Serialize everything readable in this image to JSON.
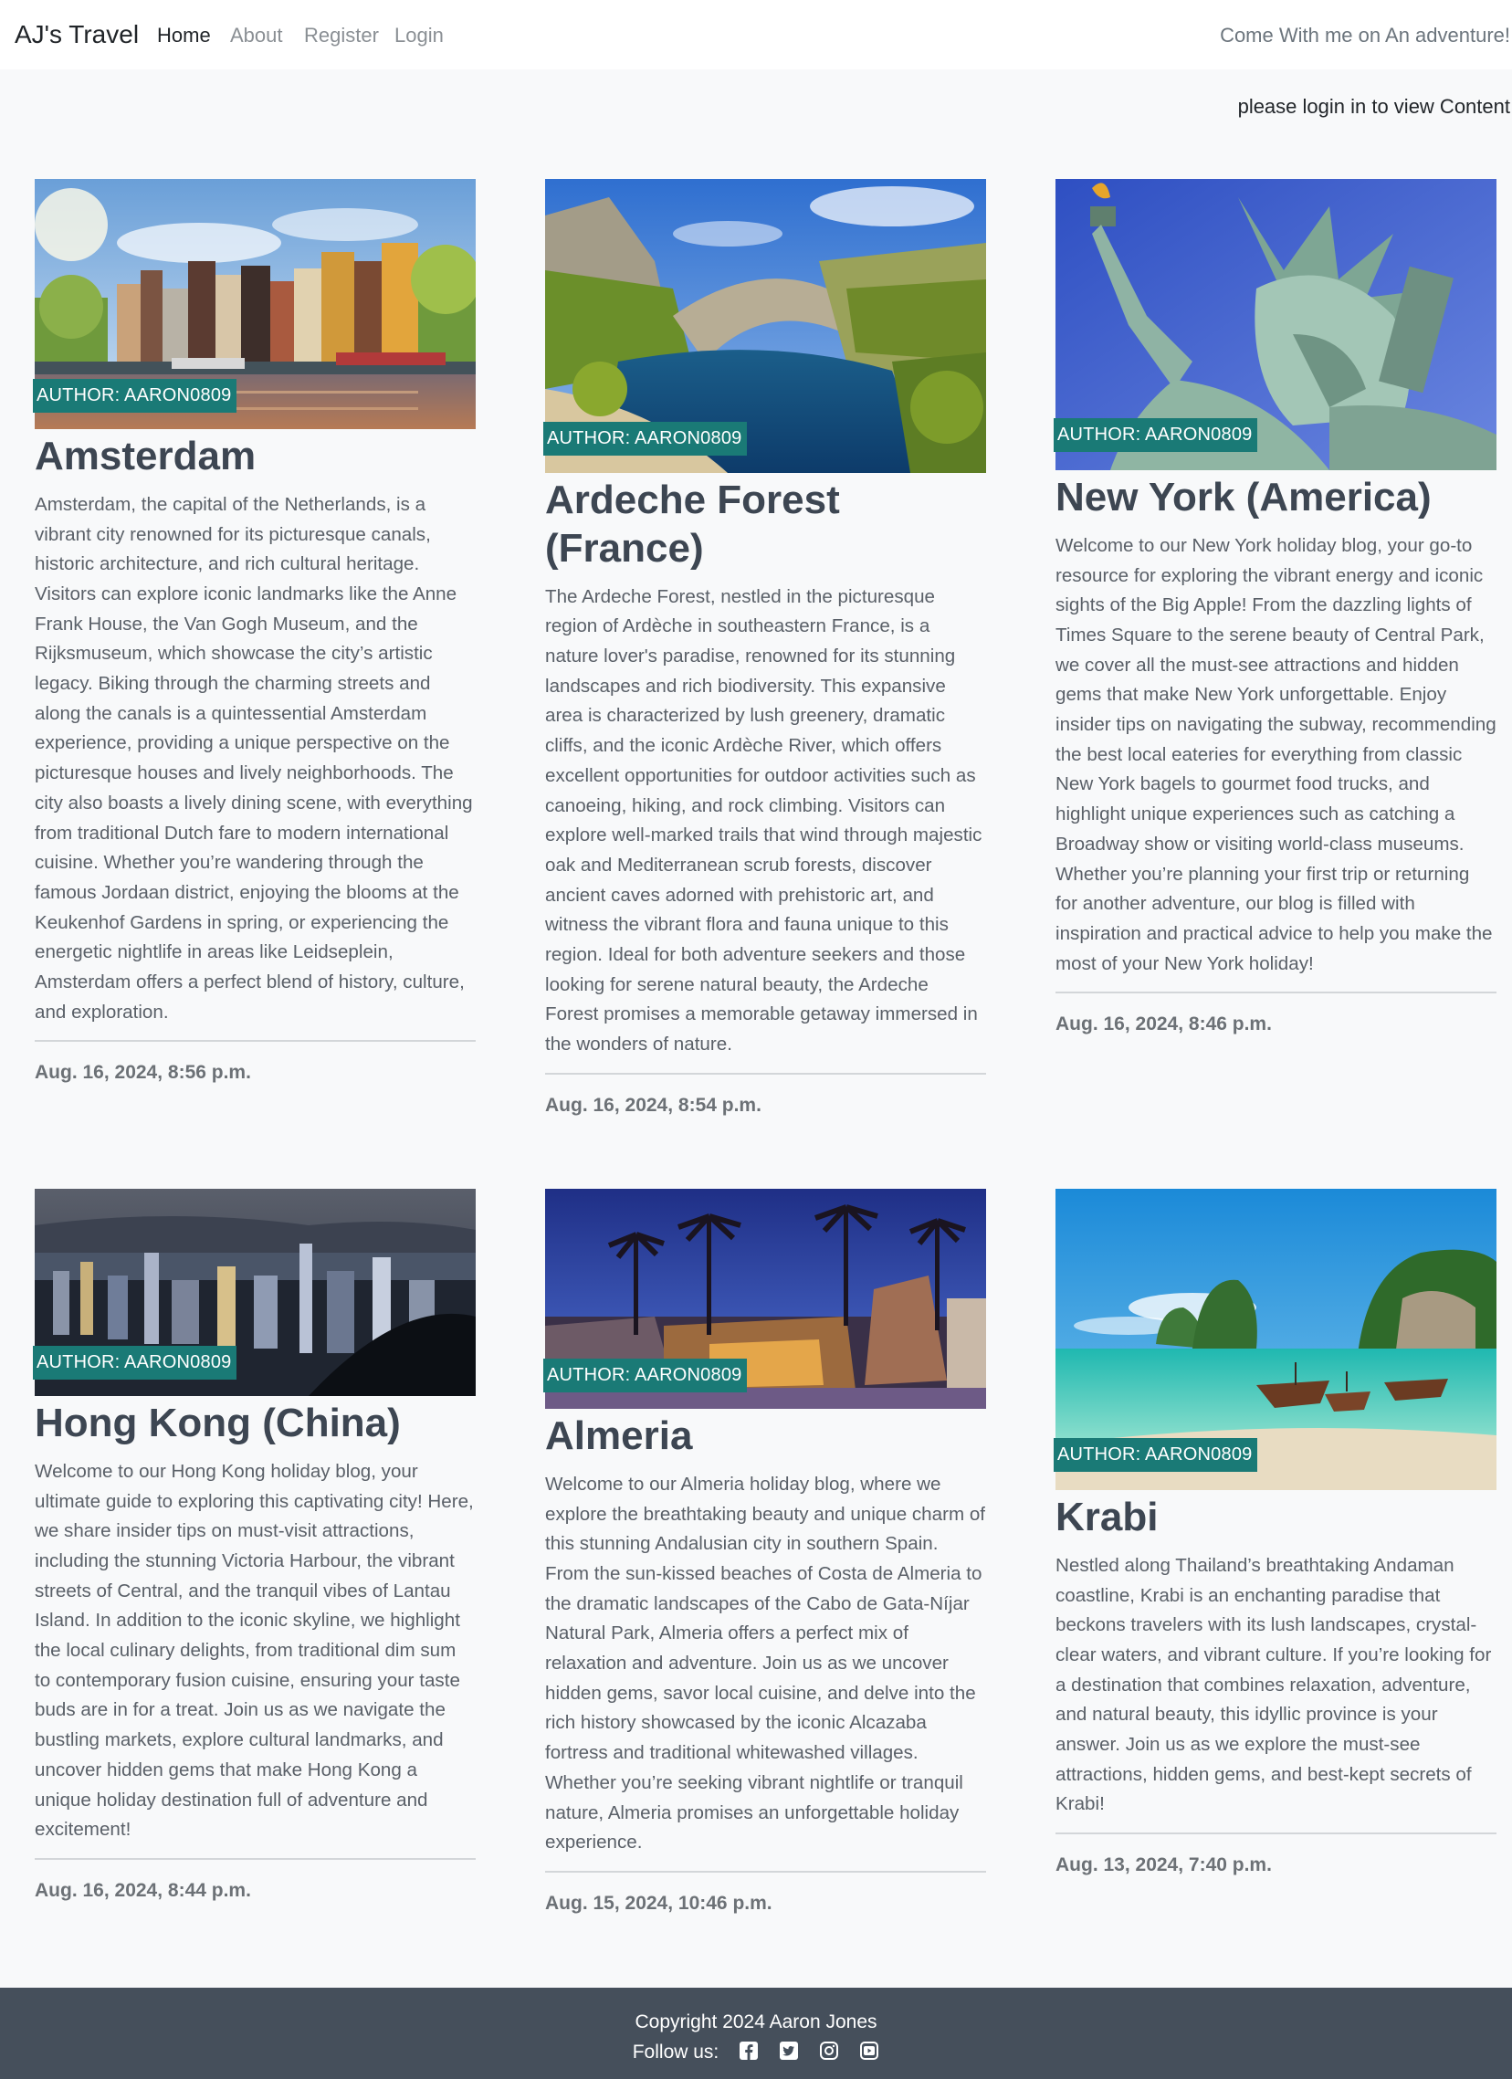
{
  "navbar": {
    "brand": "AJ's Travel",
    "links": [
      "Home",
      "About",
      "Register",
      "Login"
    ],
    "tagline": "Come With me on An adventure!"
  },
  "login_note": "please login in to view Content",
  "posts": [
    {
      "author": "AUTHOR: AARON0809",
      "title": "Amsterdam",
      "body": "Amsterdam, the capital of the Netherlands, is a vibrant city renowned for its picturesque canals, historic architecture, and rich cultural heritage. Visitors can explore iconic landmarks like the Anne Frank House, the Van Gogh Museum, and the Rijksmuseum, which showcase the city’s artistic legacy. Biking through the charming streets and along the canals is a quintessential Amsterdam experience, providing a unique perspective on the picturesque houses and lively neighborhoods. The city also boasts a lively dining scene, with everything from traditional Dutch fare to modern international cuisine. Whether you’re wandering through the famous Jordaan district, enjoying the blooms at the Keukenhof Gardens in spring, or experiencing the energetic nightlife in areas like Leidseplein, Amsterdam offers a perfect blend of history, culture, and exploration.",
      "date": "Aug. 16, 2024, 8:56 p.m.",
      "image": "amsterdam canal houses photo"
    },
    {
      "author": "AUTHOR: AARON0809",
      "title": "Ardeche Forest (France)",
      "body": "The Ardeche Forest, nestled in the picturesque region of Ardèche in southeastern France, is a nature lover's paradise, renowned for its stunning landscapes and rich biodiversity. This expansive area is characterized by lush greenery, dramatic cliffs, and the iconic Ardèche River, which offers excellent opportunities for outdoor activities such as canoeing, hiking, and rock climbing. Visitors can explore well-marked trails that wind through majestic oak and Mediterranean scrub forests, discover ancient caves adorned with prehistoric art, and witness the vibrant flora and fauna unique to this region. Ideal for both adventure seekers and those looking for serene natural beauty, the Ardeche Forest promises a memorable getaway immersed in the wonders of nature.",
      "date": "Aug. 16, 2024, 8:54 p.m.",
      "image": "ardeche river rock arch photo"
    },
    {
      "author": "AUTHOR: AARON0809",
      "title": "New York (America)",
      "body": "Welcome to our New York holiday blog, your go-to resource for exploring the vibrant energy and iconic sights of the Big Apple! From the dazzling lights of Times Square to the serene beauty of Central Park, we cover all the must-see attractions and hidden gems that make New York unforgettable. Enjoy insider tips on navigating the subway, recommending the best local eateries for everything from classic New York bagels to gourmet food trucks, and highlight unique experiences such as catching a Broadway show or visiting world-class museums. Whether you’re planning your first trip or returning for another adventure, our blog is filled with inspiration and practical advice to help you make the most of your New York holiday!",
      "date": "Aug. 16, 2024, 8:46 p.m.",
      "image": "statue of liberty photo"
    },
    {
      "author": "AUTHOR: AARON0809",
      "title": "Hong Kong (China)",
      "body": "Welcome to our Hong Kong holiday blog, your ultimate guide to exploring this captivating city! Here, we share insider tips on must-visit attractions, including the stunning Victoria Harbour, the vibrant streets of Central, and the tranquil vibes of Lantau Island. In addition to the iconic skyline, we highlight the local culinary delights, from traditional dim sum to contemporary fusion cuisine, ensuring your taste buds are in for a treat. Join us as we navigate the bustling markets, explore cultural landmarks, and uncover hidden gems that make Hong Kong a unique holiday destination full of adventure and excitement!",
      "date": "Aug. 16, 2024, 8:44 p.m.",
      "image": "hong kong night skyline photo"
    },
    {
      "author": "AUTHOR: AARON0809",
      "title": "Almeria",
      "body": "Welcome to our Almeria holiday blog, where we explore the breathtaking beauty and unique charm of this stunning Andalusian city in southern Spain. From the sun-kissed beaches of Costa de Almeria to the dramatic landscapes of the Cabo de Gata-Níjar Natural Park, Almeria offers a perfect mix of relaxation and adventure. Join us as we uncover hidden gems, savor local cuisine, and delve into the rich history showcased by the iconic Alcazaba fortress and traditional whitewashed villages. Whether you’re seeking vibrant nightlife or tranquil nature, Almeria promises an unforgettable holiday experience.",
      "date": "Aug. 15, 2024, 10:46 p.m.",
      "image": "almeria palm trees cathedral photo"
    },
    {
      "author": "AUTHOR: AARON0809",
      "title": "Krabi",
      "body": "Nestled along Thailand’s breathtaking Andaman coastline, Krabi is an enchanting paradise that beckons travelers with its lush landscapes, crystal-clear waters, and vibrant culture. If you’re looking for a destination that combines relaxation, adventure, and natural beauty, this idyllic province is your answer. Join us as we explore the must-see attractions, hidden gems, and best-kept secrets of Krabi!",
      "date": "Aug. 13, 2024, 7:40 p.m.",
      "image": "krabi beach longtail boats photo"
    }
  ],
  "footer": {
    "copyright": "Copyright 2024 Aaron Jones",
    "follow_label": "Follow us:",
    "social_icons": [
      "facebook-icon",
      "twitter-icon",
      "instagram-icon",
      "youtube-icon"
    ]
  }
}
